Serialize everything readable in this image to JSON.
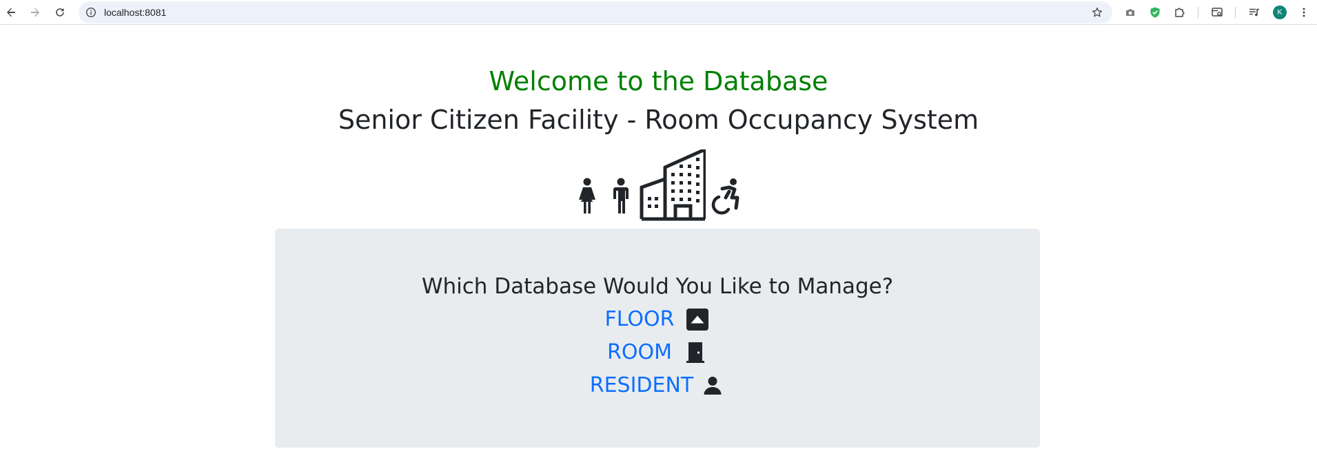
{
  "browser": {
    "url": "localhost:8081",
    "profile_initial": "K",
    "icons": {
      "back": "arrow-left-icon",
      "forward": "arrow-right-icon",
      "reload": "reload-icon",
      "site_info": "info-icon",
      "bookmark": "star-icon",
      "screenshot": "camera-icon",
      "extension_shield": "shield-check-icon",
      "extensions": "puzzle-icon",
      "tab_search": "tab-search-icon",
      "media_controls": "queue-music-icon",
      "menu": "kebab-menu-icon"
    }
  },
  "page": {
    "welcome": "Welcome to the Database",
    "subtitle": "Senior Citizen Facility - Room Occupancy System",
    "hero_icons": [
      "woman-icon",
      "man-icon",
      "building-icon",
      "wheelchair-icon"
    ],
    "question": "Which Database Would You Like to Manage?",
    "links": [
      {
        "label": "FLOOR",
        "icon": "caret-up-square-icon"
      },
      {
        "label": "ROOM",
        "icon": "door-closed-icon"
      },
      {
        "label": "RESIDENT",
        "icon": "person-icon"
      }
    ]
  },
  "colors": {
    "welcome": "#008000",
    "heading": "#212529",
    "link": "#0d6efd",
    "panel": "#e9ecef",
    "omnibox": "#edf2fa"
  }
}
